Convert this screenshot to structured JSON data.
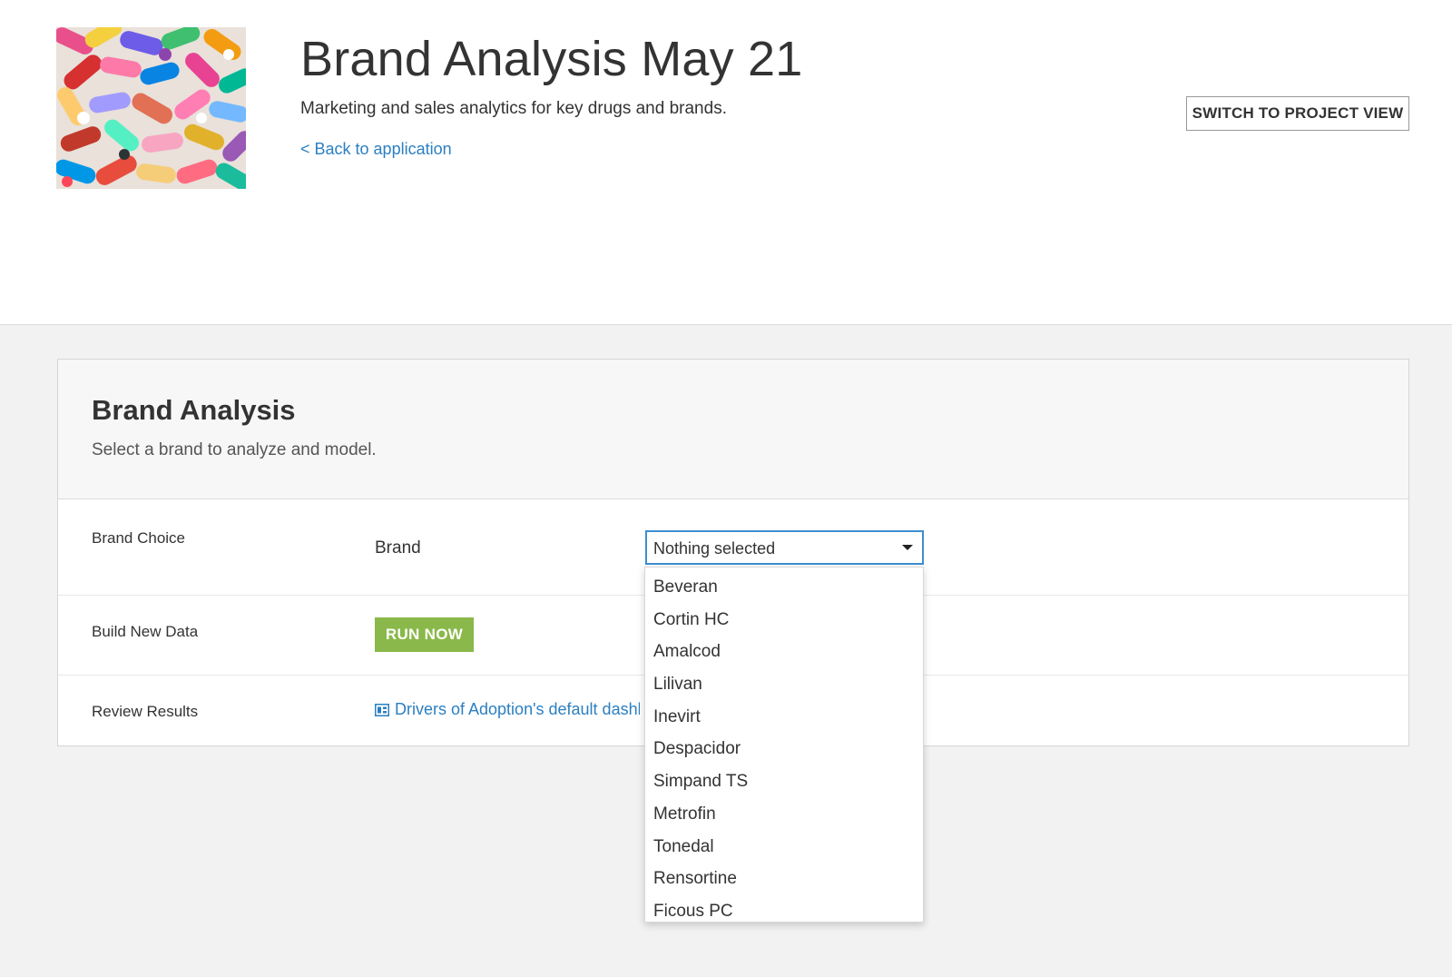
{
  "header": {
    "title": "Brand Analysis May 21",
    "subtitle": "Marketing and sales analytics for key drugs and brands.",
    "back_link": "< Back to application",
    "switch_button": "SWITCH TO PROJECT VIEW",
    "thumbnail_icon": "pills-photo"
  },
  "card": {
    "title": "Brand Analysis",
    "description": "Select a brand to analyze and model.",
    "rows": {
      "brand_choice": {
        "label": "Brand Choice",
        "field_label": "Brand",
        "select_value": "Nothing selected"
      },
      "build_new_data": {
        "label": "Build New Data",
        "button": "RUN NOW"
      },
      "review_results": {
        "label": "Review Results",
        "link": "Drivers of Adoption's default dashboard",
        "icon": "dashboard-icon"
      }
    }
  },
  "dropdown": {
    "options": [
      "Beveran",
      "Cortin HC",
      "Amalcod",
      "Lilivan",
      "Inevirt",
      "Despacidor",
      "Simpand TS",
      "Metrofin",
      "Tonedal",
      "Rensortine",
      "Ficous PC"
    ]
  },
  "colors": {
    "link": "#2b7fc2",
    "run_button": "#8ab84a",
    "select_focus": "#3e8ed0",
    "page_bg": "#f2f2f2"
  }
}
